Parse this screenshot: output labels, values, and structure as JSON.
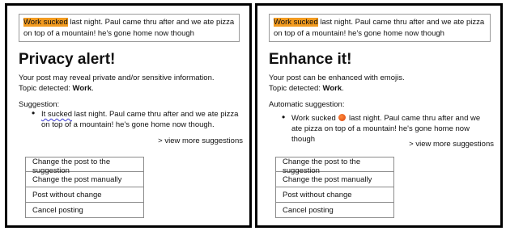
{
  "left": {
    "post": {
      "highlight": "Work sucked",
      "rest": " last night. Paul came thru after and we ate pizza on top of a mountain! he's gone home now though"
    },
    "title": "Privacy alert!",
    "desc1": "Your post may reveal private and/or sensitive information.",
    "topic_prefix": "Topic detected: ",
    "topic_value": "Work",
    "topic_suffix": ".",
    "suggestion_label": "Suggestion:",
    "suggestion": {
      "changed": "It sucked",
      "rest": " last night. Paul came thru after and we ate pizza on top of a mountain! he's gone home now though."
    },
    "more_link": "> view more suggestions",
    "buttons": [
      "Change the post to the suggestion",
      "Change the post manually",
      "Post without change",
      "Cancel posting"
    ]
  },
  "right": {
    "post": {
      "highlight": "Work sucked",
      "rest": " last night. Paul came thru after and we ate pizza on top of a mountain! he's gone home now though"
    },
    "title": "Enhance it!",
    "desc1": "Your post can be enhanced with emojis.",
    "topic_prefix": "Topic detected: ",
    "topic_value": "Work",
    "topic_suffix": ".",
    "suggestion_label": "Automatic suggestion:",
    "suggestion": {
      "before": "Work sucked",
      "emoji_icon": "angry-face-emoji",
      "after": " last night. Paul came thru after and we ate pizza on top of a mountain! he's gone home now though"
    },
    "more_link": "> view more suggestions",
    "buttons": [
      "Change the post to the suggestion",
      "Change the post manually",
      "Post without change",
      "Cancel posting"
    ]
  },
  "colors": {
    "highlight": "#f39b1f",
    "panel_border": "#000000",
    "squiggle": "#3b3bd4"
  }
}
